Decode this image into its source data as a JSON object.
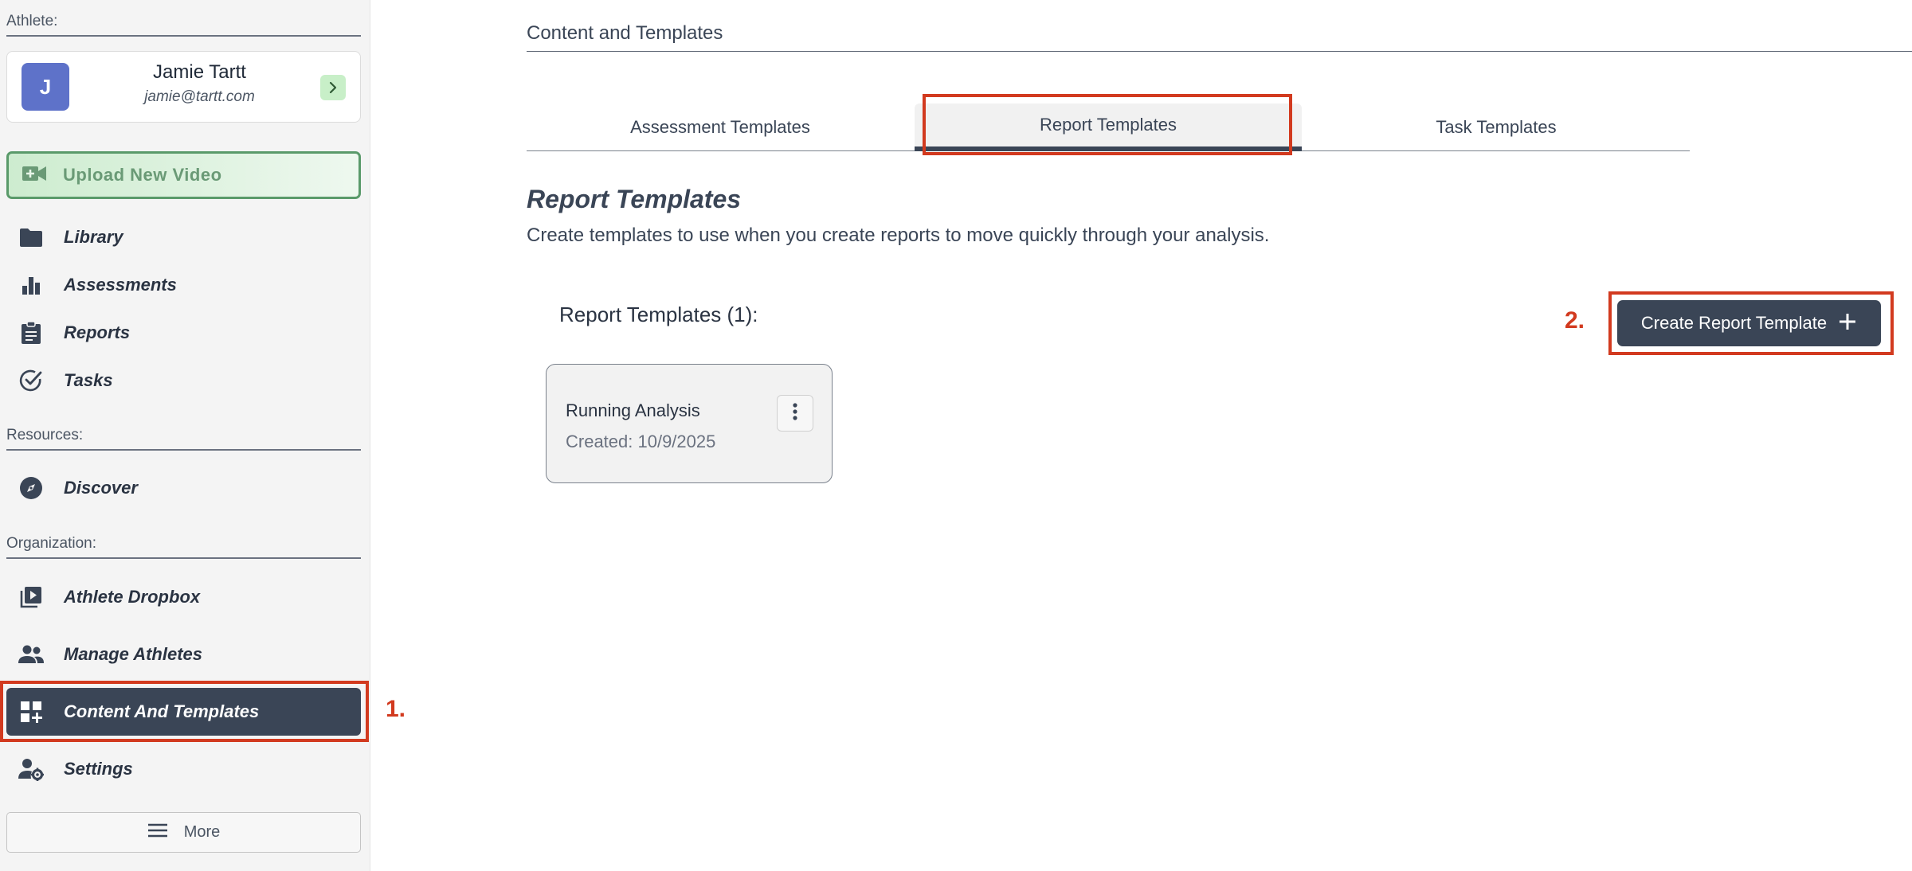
{
  "sidebar": {
    "athlete_section_label": "Athlete:",
    "athlete": {
      "initial": "J",
      "name": "Jamie Tartt",
      "email": "jamie@tartt.com"
    },
    "upload_label": "Upload New Video",
    "nav_main": [
      {
        "label": "Library",
        "icon": "folder-icon"
      },
      {
        "label": "Assessments",
        "icon": "bar-chart-icon"
      },
      {
        "label": "Reports",
        "icon": "clipboard-icon"
      },
      {
        "label": "Tasks",
        "icon": "check-circle-icon"
      }
    ],
    "resources_section_label": "Resources:",
    "nav_resources": [
      {
        "label": "Discover",
        "icon": "compass-icon"
      }
    ],
    "organization_section_label": "Organization:",
    "nav_org": [
      {
        "label": "Athlete Dropbox",
        "icon": "video-library-icon"
      },
      {
        "label": "Manage Athletes",
        "icon": "people-icon"
      },
      {
        "label": "Content And Templates",
        "icon": "dashboard-add-icon",
        "active": true
      },
      {
        "label": "Settings",
        "icon": "user-gear-icon"
      }
    ],
    "more_label": "More"
  },
  "main": {
    "breadcrumb": "Content and Templates",
    "tabs": [
      {
        "label": "Assessment Templates"
      },
      {
        "label": "Report Templates",
        "active": true
      },
      {
        "label": "Task Templates"
      }
    ],
    "title": "Report Templates",
    "description": "Create templates to use when you create reports to move quickly through your analysis.",
    "list_heading": "Report Templates (1):",
    "create_button_label": "Create Report Template",
    "templates": [
      {
        "name": "Running Analysis",
        "created": "Created: 10/9/2025"
      }
    ]
  },
  "annotations": {
    "step1": "1.",
    "step2": "2."
  },
  "colors": {
    "primary_dark": "#3a4556",
    "annotation_red": "#d23a1f",
    "upload_green": "#5a9a6a",
    "avatar_blue": "#5e72c9"
  }
}
